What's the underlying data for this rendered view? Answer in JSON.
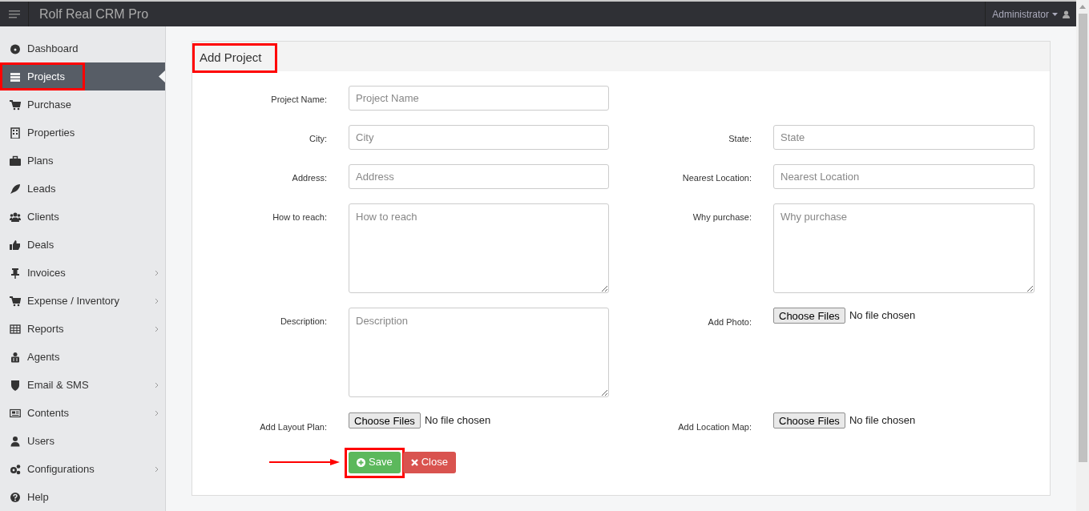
{
  "app": {
    "title": "Rolf Real CRM Pro",
    "user": "Administrator"
  },
  "sidebar": {
    "items": [
      {
        "label": "Dashboard",
        "selected": false,
        "has_submenu": false,
        "highlighted": false
      },
      {
        "label": "Projects",
        "selected": true,
        "has_submenu": false,
        "highlighted": true
      },
      {
        "label": "Purchase",
        "selected": false,
        "has_submenu": false,
        "highlighted": false
      },
      {
        "label": "Properties",
        "selected": false,
        "has_submenu": false,
        "highlighted": false
      },
      {
        "label": "Plans",
        "selected": false,
        "has_submenu": false,
        "highlighted": false
      },
      {
        "label": "Leads",
        "selected": false,
        "has_submenu": false,
        "highlighted": false
      },
      {
        "label": "Clients",
        "selected": false,
        "has_submenu": false,
        "highlighted": false
      },
      {
        "label": "Deals",
        "selected": false,
        "has_submenu": false,
        "highlighted": false
      },
      {
        "label": "Invoices",
        "selected": false,
        "has_submenu": true,
        "highlighted": false
      },
      {
        "label": "Expense / Inventory",
        "selected": false,
        "has_submenu": true,
        "highlighted": false
      },
      {
        "label": "Reports",
        "selected": false,
        "has_submenu": true,
        "highlighted": false
      },
      {
        "label": "Agents",
        "selected": false,
        "has_submenu": false,
        "highlighted": false
      },
      {
        "label": "Email & SMS",
        "selected": false,
        "has_submenu": true,
        "highlighted": false
      },
      {
        "label": "Contents",
        "selected": false,
        "has_submenu": true,
        "highlighted": false
      },
      {
        "label": "Users",
        "selected": false,
        "has_submenu": false,
        "highlighted": false
      },
      {
        "label": "Configurations",
        "selected": false,
        "has_submenu": true,
        "highlighted": false
      },
      {
        "label": "Help",
        "selected": false,
        "has_submenu": false,
        "highlighted": false
      }
    ]
  },
  "form": {
    "title": "Add Project",
    "title_highlighted": true,
    "rows": [
      [
        {
          "label": "Project Name:",
          "kind": "text",
          "placeholder": "Project Name"
        }
      ],
      [
        {
          "label": "City:",
          "kind": "text",
          "placeholder": "City"
        },
        {
          "label": "State:",
          "kind": "text",
          "placeholder": "State"
        }
      ],
      [
        {
          "label": "Address:",
          "kind": "text",
          "placeholder": "Address"
        },
        {
          "label": "Nearest Location:",
          "kind": "text",
          "placeholder": "Nearest Location"
        }
      ],
      [
        {
          "label": "How to reach:",
          "kind": "textarea",
          "placeholder": "How to reach"
        },
        {
          "label": "Why purchase:",
          "kind": "textarea",
          "placeholder": "Why purchase"
        }
      ],
      [
        {
          "label": "Description:",
          "kind": "textarea",
          "placeholder": "Description"
        },
        {
          "label": "Add Photo:",
          "kind": "file",
          "button": "Choose Files",
          "status": "No file chosen"
        }
      ],
      [
        {
          "label": "Add Layout Plan:",
          "kind": "file",
          "button": "Choose Files",
          "status": "No file chosen"
        },
        {
          "label": "Add Location Map:",
          "kind": "file",
          "button": "Choose Files",
          "status": "No file chosen"
        }
      ]
    ],
    "buttons": [
      {
        "label": "Save",
        "kind": "save",
        "highlighted": true,
        "pointer_arrow": true
      },
      {
        "label": "Close",
        "kind": "close",
        "highlighted": false,
        "pointer_arrow": false
      }
    ]
  }
}
